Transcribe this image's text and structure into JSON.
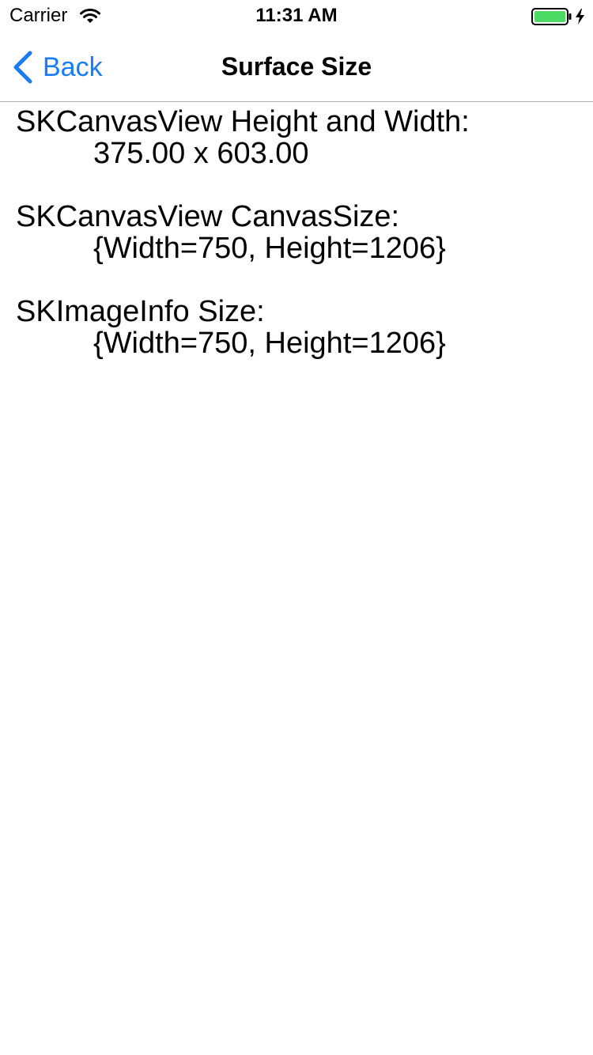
{
  "status_bar": {
    "carrier": "Carrier",
    "time": "11:31 AM",
    "battery_color": "#4cd964"
  },
  "nav_bar": {
    "back_label": "Back",
    "title": "Surface Size",
    "accent_color": "#1a7cf5"
  },
  "content": {
    "items": [
      {
        "label": "SKCanvasView Height and Width:",
        "value": "375.00 x 603.00"
      },
      {
        "label": "SKCanvasView CanvasSize:",
        "value": "{Width=750, Height=1206}"
      },
      {
        "label": "SKImageInfo Size:",
        "value": "{Width=750, Height=1206}"
      }
    ]
  }
}
